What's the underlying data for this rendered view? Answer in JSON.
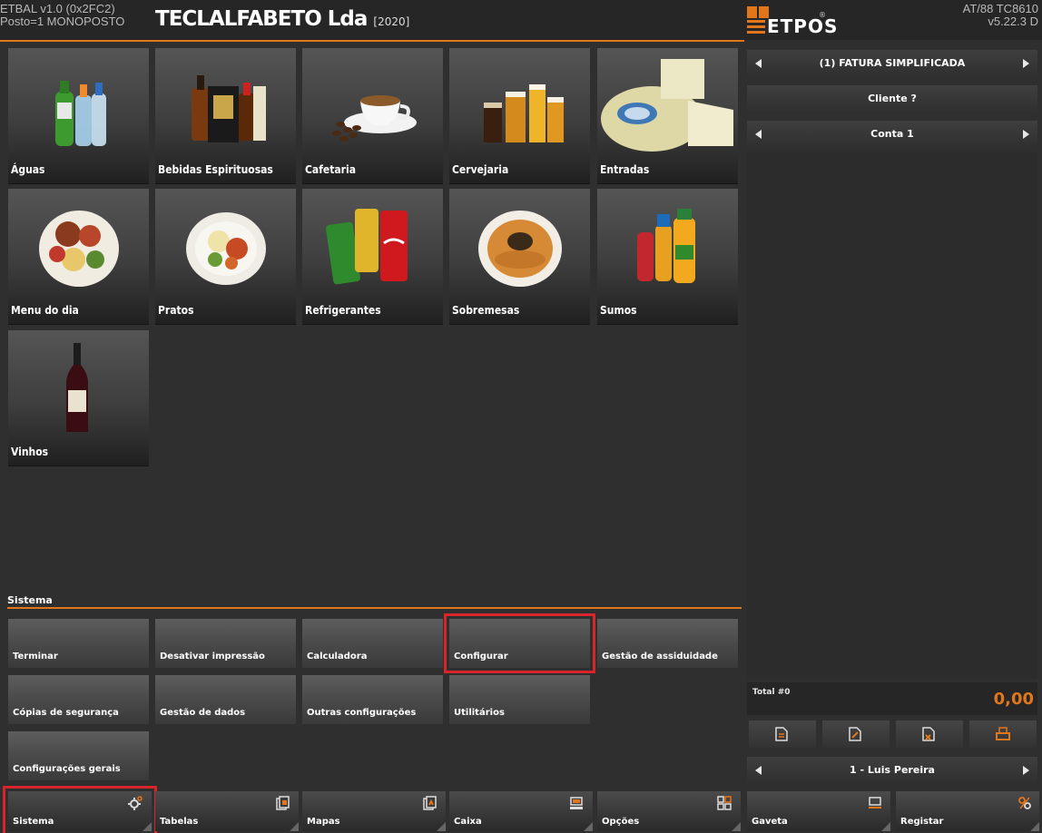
{
  "header": {
    "sys_line1": "ETBAL v1.0 (0x2FC2)",
    "sys_line2": "Posto=1 MONOPOSTO",
    "company": "TECLALFABETO Lda",
    "year": "[2020]",
    "logo_text": "ETPOS",
    "logo_reg": "®",
    "version_line1": "AT/88 TC8610",
    "version_line2": "v5.22.3 D"
  },
  "categories": [
    {
      "label": "Águas",
      "icon": "water-bottles-icon"
    },
    {
      "label": "Bebidas Espirituosas",
      "icon": "spirits-bottles-icon"
    },
    {
      "label": "Cafetaria",
      "icon": "coffee-cup-icon"
    },
    {
      "label": "Cervejaria",
      "icon": "beer-glasses-icon"
    },
    {
      "label": "Entradas",
      "icon": "cheese-icon"
    },
    {
      "label": "Menu do dia",
      "icon": "food-platter-icon"
    },
    {
      "label": "Pratos",
      "icon": "dish-plate-icon"
    },
    {
      "label": "Refrigerantes",
      "icon": "soda-cans-icon"
    },
    {
      "label": "Sobremesas",
      "icon": "cake-icon"
    },
    {
      "label": "Sumos",
      "icon": "juice-bottles-icon"
    },
    {
      "label": "Vinhos",
      "icon": "wine-bottle-icon"
    }
  ],
  "system": {
    "title": "Sistema",
    "buttons": [
      "Terminar",
      "Desativar impressão",
      "Calculadora",
      "Configurar",
      "Gestão de assiduidade",
      "Cópias de segurança",
      "Gestão de dados",
      "Outras configurações",
      "Utilitários",
      "Configurações gerais"
    ]
  },
  "bottom_nav": [
    {
      "label": "Sistema",
      "icon": "gear-icon"
    },
    {
      "label": "Tabelas",
      "icon": "tables-icon"
    },
    {
      "label": "Mapas",
      "icon": "maps-icon"
    },
    {
      "label": "Caixa",
      "icon": "cash-register-icon"
    },
    {
      "label": "Opções",
      "icon": "grid-icon"
    }
  ],
  "right": {
    "doc_type": "(1) FATURA SIMPLIFICADA",
    "client": "Cliente ?",
    "account": "Conta 1",
    "total_label": "Total #0",
    "total_value": "0,00",
    "operator": "1 - Luis Pereira",
    "drawer": "Gaveta",
    "register": "Registar"
  },
  "colors": {
    "accent": "#e2761b",
    "highlight": "#d8242b",
    "background": "#2f2f2f"
  }
}
